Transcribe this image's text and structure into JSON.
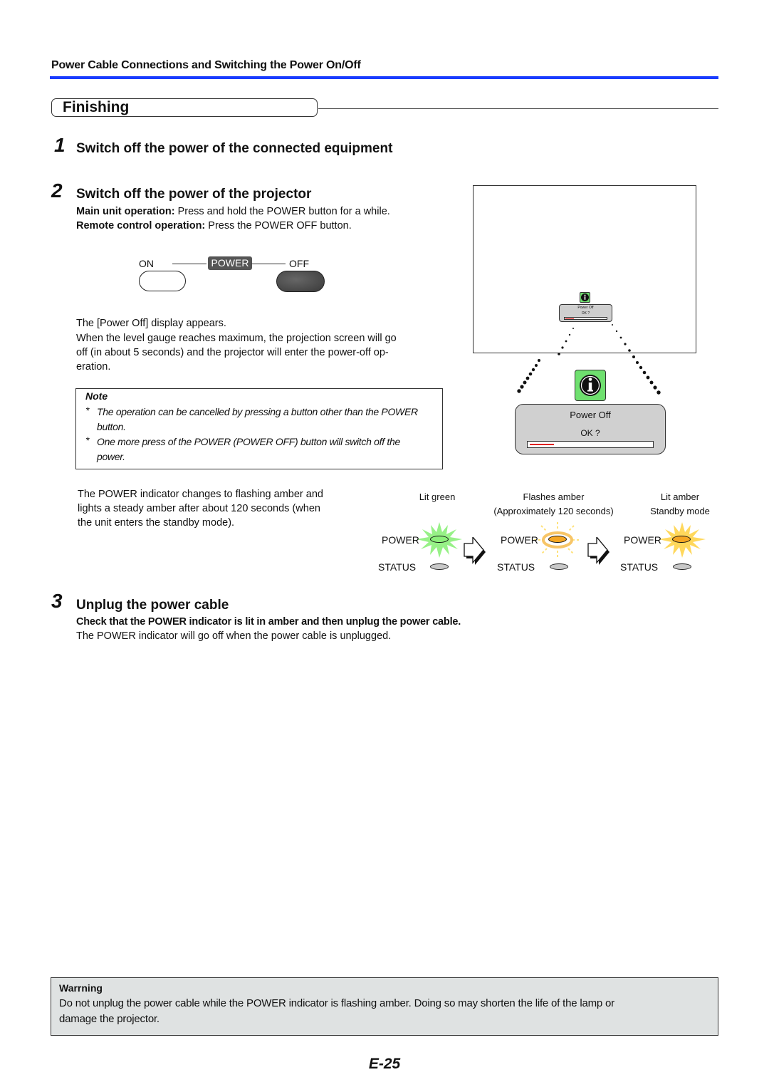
{
  "header": {
    "section_title": "Power Cable Connections and Switching the Power On/Off",
    "accent_color": "#1a3cff"
  },
  "subsection": {
    "title": "Finishing"
  },
  "steps": [
    {
      "number": "1",
      "title": "Switch off the power of the connected equipment"
    },
    {
      "number": "2",
      "title": "Switch off the power of the projector",
      "main_unit_label": "Main unit operation:",
      "main_unit_text": " Press and hold the POWER button for a while.",
      "remote_label": "Remote control operation:",
      "remote_text": " Press the POWER OFF button.",
      "para1": "The [Power Off] display appears.",
      "para2_line1": "When the level gauge reaches maximum, the projection screen will go",
      "para2_line2": "off (in about 5 seconds) and the projector will enter the power-off op-",
      "para2_line3": "eration.",
      "indicator_para_line1": "The POWER indicator changes to flashing amber and",
      "indicator_para_line2": "lights a steady amber after about 120 seconds (when",
      "indicator_para_line3": "the unit enters the standby mode)."
    },
    {
      "number": "3",
      "title": "Unplug the power cable",
      "bold_text": "Check that the POWER indicator is lit in amber and then unplug the power cable.",
      "text": "The POWER indicator will go off when the power cable is unplugged."
    }
  ],
  "power_panel": {
    "on_label": "ON",
    "power_label": "POWER",
    "off_label": "OFF"
  },
  "note": {
    "title": "Note",
    "items": [
      {
        "star": "*",
        "line1": "The operation can be cancelled by pressing a button other than the POWER",
        "line2": "button."
      },
      {
        "star": "*",
        "line1": "One more press of the POWER (POWER OFF) button will switch off the",
        "line2": "power."
      }
    ]
  },
  "dialog": {
    "icon": "info-icon",
    "title": "Power Off",
    "prompt": "OK ?",
    "gauge_progress": 0.2,
    "gauge_color": "#e02020"
  },
  "indicator_states": [
    {
      "label": "Lit green",
      "sublabel": "",
      "power": "POWER",
      "status": "STATUS",
      "color": "#8cf07a"
    },
    {
      "label": "Flashes amber",
      "sublabel": "(Approximately 120 seconds)",
      "power": "POWER",
      "status": "STATUS",
      "color": "#f5a623"
    },
    {
      "label": "Lit amber",
      "sublabel": "Standby mode",
      "power": "POWER",
      "status": "STATUS",
      "color": "#f5a623"
    }
  ],
  "warning": {
    "title": "Warrning",
    "line1": "Do not unplug the power cable while the POWER indicator is flashing amber. Doing so may shorten the life of the lamp or",
    "line2": "damage the projector."
  },
  "page_number": "E-25"
}
